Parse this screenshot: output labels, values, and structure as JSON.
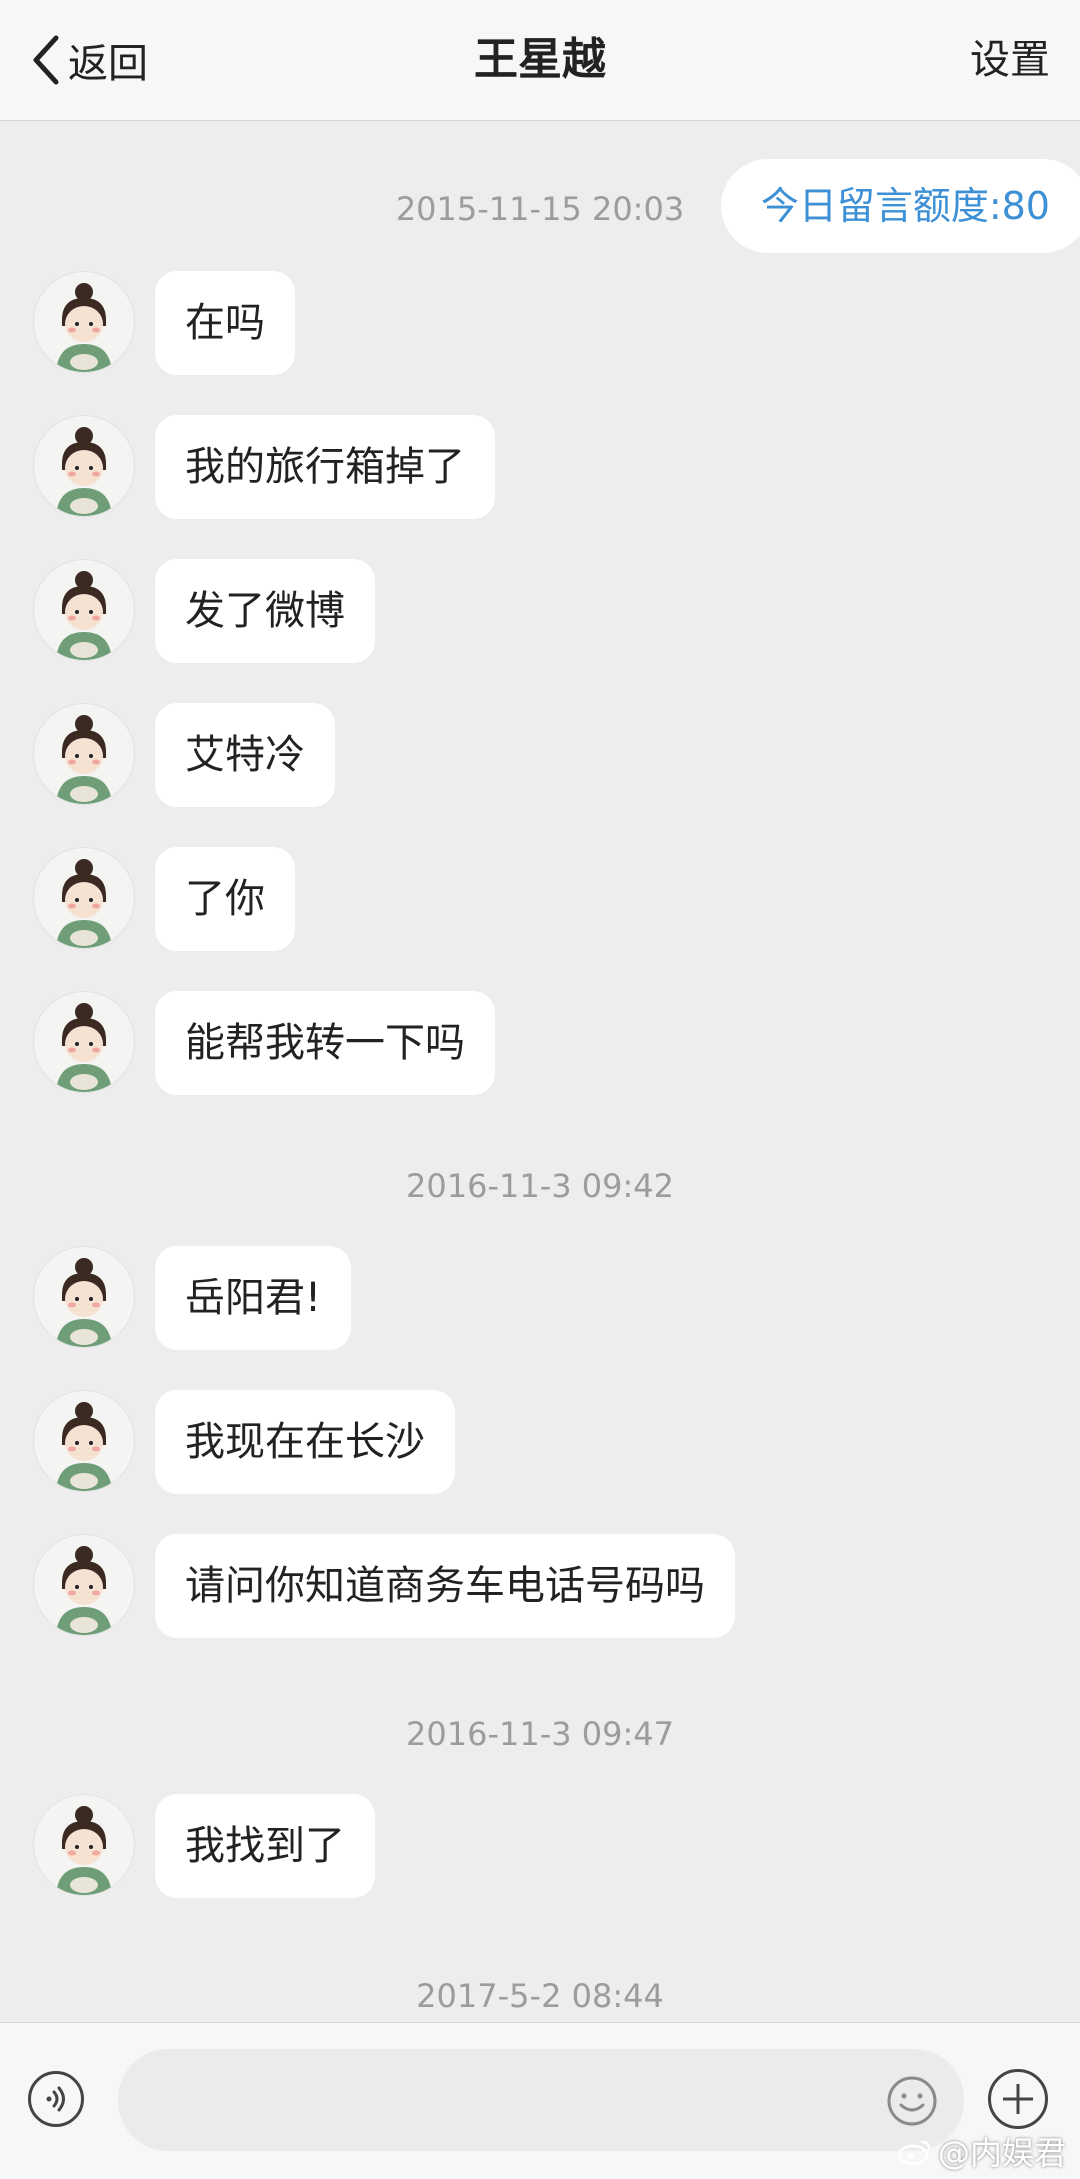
{
  "header": {
    "back_label": "返回",
    "title": "王星越",
    "settings_label": "设置"
  },
  "quota_text": "今日留言额度:80",
  "timestamps": [
    "2015-11-15 20:03",
    "2016-11-3 09:42",
    "2016-11-3 09:47",
    "2017-5-2 08:44"
  ],
  "messages": [
    {
      "text": "在吗"
    },
    {
      "text": "我的旅行箱掉了"
    },
    {
      "text": "发了微博"
    },
    {
      "text": "艾特冷"
    },
    {
      "text": "了你"
    },
    {
      "text": "能帮我转一下吗"
    },
    {
      "text": "岳阳君!"
    },
    {
      "text": "我现在在长沙"
    },
    {
      "text": "请问你知道商务车电话号码吗"
    },
    {
      "text": "我找到了"
    }
  ],
  "input": {
    "placeholder": ""
  },
  "icons": {
    "back": "chevron-left-icon",
    "voice": "voice-icon",
    "emoji": "emoji-icon",
    "plus": "plus-icon",
    "avatar": "cartoon-avatar"
  },
  "watermark": "@内娱君",
  "colors": {
    "accent": "#3d8fd6",
    "background": "#ededed",
    "bubble": "#ffffff"
  }
}
